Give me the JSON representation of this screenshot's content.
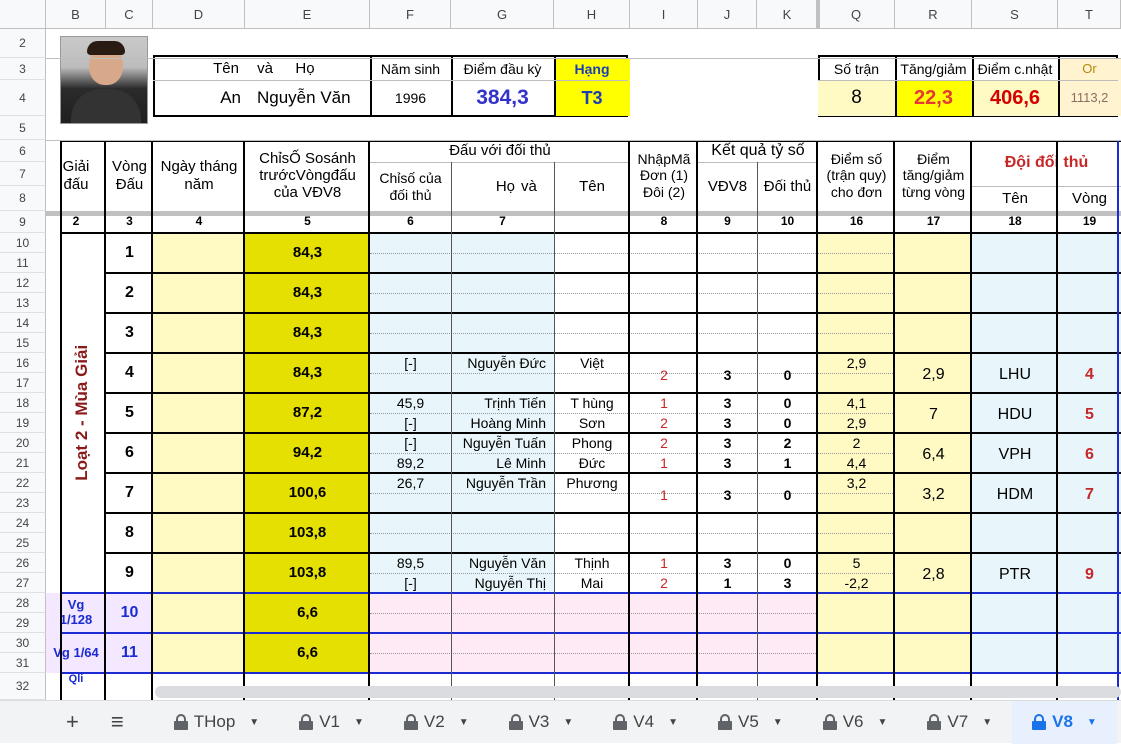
{
  "columns": [
    {
      "key": "B",
      "label": "B"
    },
    {
      "key": "C",
      "label": "C"
    },
    {
      "key": "D",
      "label": "D"
    },
    {
      "key": "E",
      "label": "E"
    },
    {
      "key": "F",
      "label": "F"
    },
    {
      "key": "G",
      "label": "G"
    },
    {
      "key": "H",
      "label": "H"
    },
    {
      "key": "I",
      "label": "I"
    },
    {
      "key": "J",
      "label": "J"
    },
    {
      "key": "K",
      "label": "K"
    },
    {
      "key": "Q",
      "label": "Q"
    },
    {
      "key": "R",
      "label": "R"
    },
    {
      "key": "S",
      "label": "S"
    },
    {
      "key": "T",
      "label": "T"
    }
  ],
  "rows": [
    "2",
    "3",
    "4",
    "5",
    "6",
    "7",
    "8",
    "9",
    "10",
    "11",
    "12",
    "13",
    "14",
    "15",
    "16",
    "17",
    "18",
    "19",
    "20",
    "21",
    "22",
    "23",
    "24",
    "25",
    "26",
    "27",
    "28",
    "29",
    "30",
    "31",
    "32"
  ],
  "player": {
    "name_label": "Tên",
    "and_label": "và",
    "surname_label": "Họ",
    "first_name": "An",
    "last_name": "Nguyễn Văn",
    "birth_label": "Năm sinh",
    "birth_year": "1996",
    "start_points_label": "Điểm đầu kỳ",
    "start_points": "384,3",
    "rank_label": "Hạng",
    "rank": "T3"
  },
  "summary": {
    "matches_label": "Số trận",
    "matches": "8",
    "change_label": "Tăng/giảm",
    "change": "22,3",
    "updated_label": "Điểm c.nhật",
    "updated": "406,6",
    "or_label": "Or",
    "or_value": "1113,2"
  },
  "headers": {
    "tournament": "Giải đấu",
    "round": "Vòng Đấu",
    "date": "Ngày tháng năm",
    "index": "ChỉsỐ Sosánh trướcVòngđấu của VĐV8",
    "vs_opponent": "Đấu với đối thủ",
    "opp_index": "Chỉsố của đối thủ",
    "ho": "Họ",
    "va": "và",
    "ten": "Tên",
    "input_code": "NhậpMã Đơn (1) Đôi (2)",
    "result": "Kết quả tỷ số",
    "vdv8": "VĐV8",
    "opponent": "Đối thủ",
    "score": "Điểm số (trận quy) cho đơn",
    "round_change": "Điểm tăng/giảm từng vòng",
    "opp_team": "Đội đối thủ",
    "team_name": "Tên",
    "team_round": "Vòng"
  },
  "col_numbers": [
    "2",
    "3",
    "4",
    "5",
    "6",
    "7",
    "8",
    "9",
    "10",
    "16",
    "17",
    "18",
    "19"
  ],
  "section_label": "Loạt 2 - Mùa Giải",
  "rounds": [
    {
      "round": "1",
      "index": "84,3",
      "matches": [],
      "delta": "",
      "team": "",
      "team_round": ""
    },
    {
      "round": "2",
      "index": "84,3",
      "matches": [],
      "delta": "",
      "team": "",
      "team_round": ""
    },
    {
      "round": "3",
      "index": "84,3",
      "matches": [],
      "delta": "",
      "team": "",
      "team_round": ""
    },
    {
      "round": "4",
      "index": "84,3",
      "matches": [
        {
          "opp_idx": "[-]",
          "ho": "Nguyễn Đức",
          "ten": "Việt",
          "code": "2",
          "a": "3",
          "b": "0",
          "pts": "2,9"
        }
      ],
      "delta": "2,9",
      "team": "LHU",
      "team_round": "4"
    },
    {
      "round": "5",
      "index": "87,2",
      "matches": [
        {
          "opp_idx": "45,9",
          "ho": "Trịnh Tiến",
          "ten": "T hùng",
          "code": "1",
          "a": "3",
          "b": "0",
          "pts": "4,1"
        },
        {
          "opp_idx": "[-]",
          "ho": "Hoàng Minh",
          "ten": "Sơn",
          "code": "2",
          "a": "3",
          "b": "0",
          "pts": "2,9"
        }
      ],
      "delta": "7",
      "team": "HDU",
      "team_round": "5"
    },
    {
      "round": "6",
      "index": "94,2",
      "matches": [
        {
          "opp_idx": "[-]",
          "ho": "Nguyễn Tuấn",
          "ten": "Phong",
          "code": "2",
          "a": "3",
          "b": "2",
          "pts": "2"
        },
        {
          "opp_idx": "89,2",
          "ho": "Lê Minh",
          "ten": "Đức",
          "code": "1",
          "a": "3",
          "b": "1",
          "pts": "4,4"
        }
      ],
      "delta": "6,4",
      "team": "VPH",
      "team_round": "6"
    },
    {
      "round": "7",
      "index": "100,6",
      "matches": [
        {
          "opp_idx": "26,7",
          "ho": "Nguyễn Trần",
          "ten": "Phương",
          "code": "1",
          "a": "3",
          "b": "0",
          "pts": "3,2"
        }
      ],
      "delta": "3,2",
      "team": "HDM",
      "team_round": "7"
    },
    {
      "round": "8",
      "index": "103,8",
      "matches": [],
      "delta": "",
      "team": "",
      "team_round": ""
    },
    {
      "round": "9",
      "index": "103,8",
      "matches": [
        {
          "opp_idx": "89,5",
          "ho": "Nguyễn Văn",
          "ten": "Thịnh",
          "code": "1",
          "a": "3",
          "b": "0",
          "pts": "5"
        },
        {
          "opp_idx": "[-]",
          "ho": "Nguyễn Thị",
          "ten": "Mai",
          "code": "2",
          "a": "1",
          "b": "3",
          "pts": "-2,2"
        }
      ],
      "delta": "2,8",
      "team": "PTR",
      "team_round": "9"
    }
  ],
  "playoffs": [
    {
      "label": "Vg 1/128",
      "round": "10",
      "index": "6,6"
    },
    {
      "label": "Vg 1/64",
      "round": "11",
      "index": "6,6"
    },
    {
      "label": "Qli",
      "round": "",
      "index": ""
    }
  ],
  "tabs": [
    {
      "label": "THop",
      "locked": true,
      "active": false
    },
    {
      "label": "V1",
      "locked": true,
      "active": false
    },
    {
      "label": "V2",
      "locked": true,
      "active": false
    },
    {
      "label": "V3",
      "locked": true,
      "active": false
    },
    {
      "label": "V4",
      "locked": true,
      "active": false
    },
    {
      "label": "V5",
      "locked": true,
      "active": false
    },
    {
      "label": "V6",
      "locked": true,
      "active": false
    },
    {
      "label": "V7",
      "locked": true,
      "active": false
    },
    {
      "label": "V8",
      "locked": true,
      "active": true
    }
  ],
  "toolbar": {
    "add_label": "+",
    "menu_label": "≡"
  },
  "colors": {
    "accent": "#1a73e8",
    "section": "#8b1a1a",
    "rank_bg": "#ffff00",
    "index_bg": "#e6e000"
  }
}
